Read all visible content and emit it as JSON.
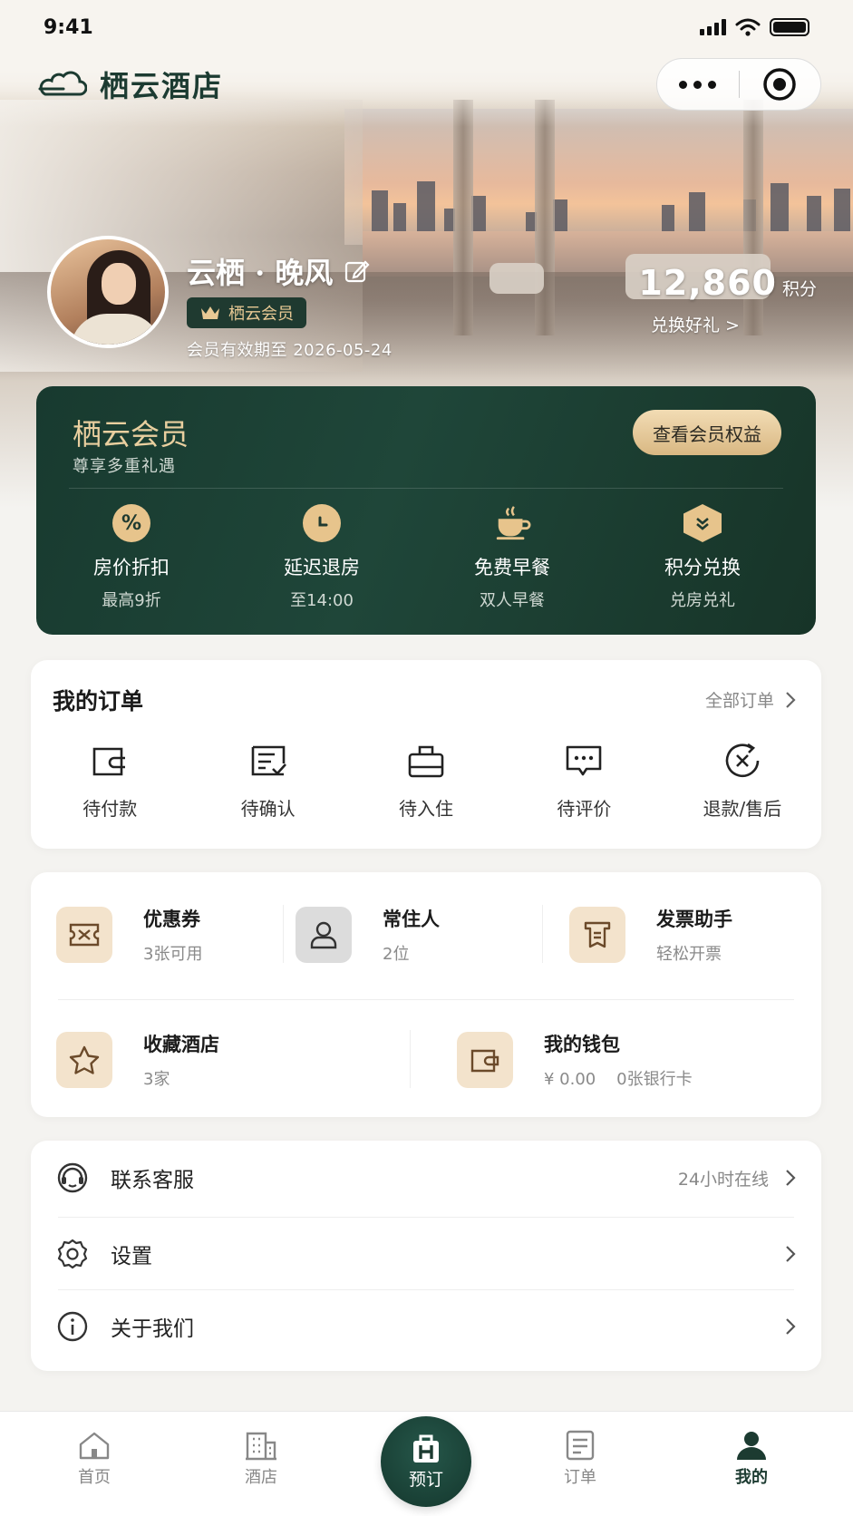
{
  "status": {
    "time": "9:41"
  },
  "brand": {
    "name": "栖云酒店"
  },
  "profile": {
    "name": "云栖 · 晚风",
    "badge": "栖云会员",
    "expiry": "会员有效期至 2026-05-24",
    "points": "12,860",
    "points_unit": "积分",
    "redeem": "兑换好礼 >"
  },
  "member": {
    "title": "栖云会员",
    "subtitle": "尊享多重礼遇",
    "benefits_button": "查看会员权益",
    "perks": [
      {
        "icon": "percent-icon",
        "title": "房价折扣",
        "sub": "最高9折"
      },
      {
        "icon": "clock-icon",
        "title": "延迟退房",
        "sub": "至14:00"
      },
      {
        "icon": "coffee-icon",
        "title": "免费早餐",
        "sub": "双人早餐"
      },
      {
        "icon": "exchange-icon",
        "title": "积分兑换",
        "sub": "兑房兑礼"
      }
    ]
  },
  "orders": {
    "title": "我的订单",
    "all": "全部订单",
    "items": [
      {
        "icon": "wallet-icon",
        "label": "待付款"
      },
      {
        "icon": "confirm-doc-icon",
        "label": "待确认"
      },
      {
        "icon": "luggage-icon",
        "label": "待入住"
      },
      {
        "icon": "comment-icon",
        "label": "待评价"
      },
      {
        "icon": "refund-icon",
        "label": "退款/售后"
      }
    ]
  },
  "tools": {
    "coupon": {
      "title": "优惠券",
      "sub": "3张可用"
    },
    "guests": {
      "title": "常住人",
      "sub": "2位"
    },
    "invoice": {
      "title": "发票助手",
      "sub": "轻松开票"
    },
    "favorites": {
      "title": "收藏酒店",
      "sub": "3家"
    },
    "wallet": {
      "title": "我的钱包",
      "balance": "¥ 0.00",
      "cards": "0张银行卡"
    }
  },
  "menu": [
    {
      "icon": "customer-service-icon",
      "label": "联系客服",
      "right": "24小时在线"
    },
    {
      "icon": "settings-icon",
      "label": "设置",
      "right": ""
    },
    {
      "icon": "info-icon",
      "label": "关于我们",
      "right": ""
    }
  ],
  "tabbar": {
    "home": "首页",
    "hotel": "酒店",
    "book": "预订",
    "orders": "订单",
    "mine": "我的"
  },
  "colors": {
    "primary": "#1c3b31",
    "gold": "#e7c48c",
    "accent_bg": "#f3e3cc"
  }
}
